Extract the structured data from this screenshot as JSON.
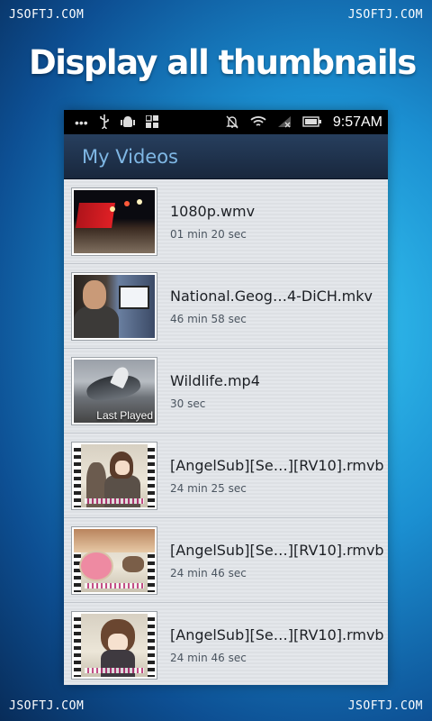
{
  "watermark": "JSOFTJ.COM",
  "headline": "Display all thumbnails",
  "statusbar": {
    "time": "9:57AM",
    "icons": [
      "more-dots-icon",
      "usb-icon",
      "android-debug-icon",
      "apps-icon",
      "silent-icon",
      "wifi-icon",
      "no-signal-icon",
      "battery-icon"
    ]
  },
  "actionbar": {
    "title": "My Videos"
  },
  "videos": [
    {
      "name": "1080p.wmv",
      "duration": "01 min 20 sec",
      "badge": ""
    },
    {
      "name": "National.Geog…4-DiCH.mkv",
      "duration": "46 min 58 sec",
      "badge": ""
    },
    {
      "name": "Wildlife.mp4",
      "duration": "30 sec",
      "badge": "Last Played"
    },
    {
      "name": "[AngelSub][Se…][RV10].rmvb",
      "duration": "24 min 25 sec",
      "badge": ""
    },
    {
      "name": "[AngelSub][Se…][RV10].rmvb",
      "duration": "24 min 46 sec",
      "badge": ""
    },
    {
      "name": "[AngelSub][Se…][RV10].rmvb",
      "duration": "24 min 46 sec",
      "badge": ""
    }
  ]
}
